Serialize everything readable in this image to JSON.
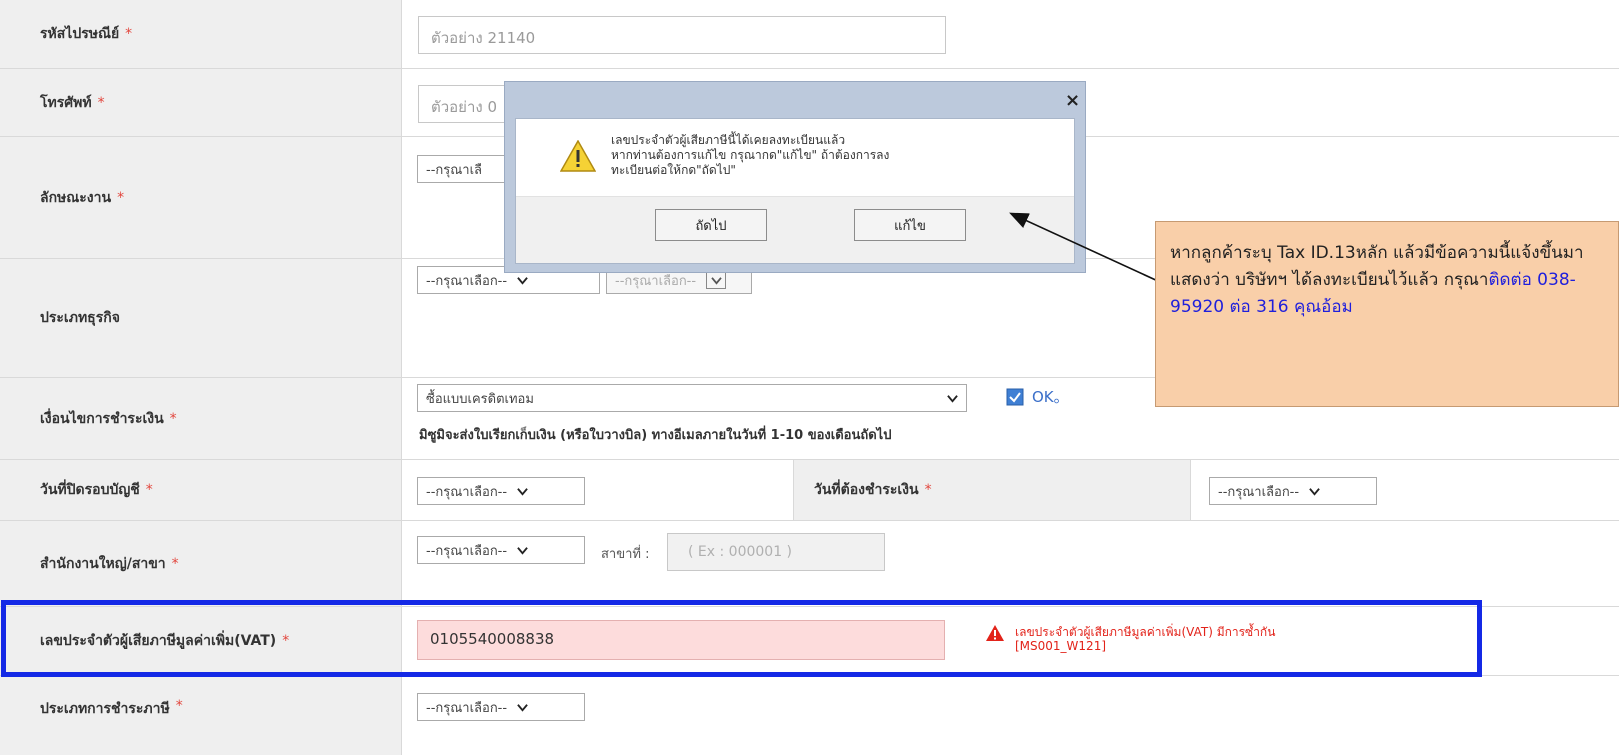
{
  "form": {
    "postal": {
      "label": "รหัสไปรษณีย์",
      "req": "*",
      "placeholder": "ตัวอย่าง 21140"
    },
    "phone": {
      "label": "โทรศัพท์",
      "req": "*",
      "placeholder": "ตัวอย่าง 0"
    },
    "job_type": {
      "label": "ลักษณะงาน",
      "req": "*",
      "select": "--กรุณาเลื"
    },
    "business_type": {
      "label": "ประเภทธุรกิจ",
      "select1": "--กรุณาเลือก--",
      "select2": "--กรุณาเลือก--"
    },
    "payment_terms": {
      "label": "เงื่อนไขการชำระเงิน",
      "req": "*",
      "select": "ซื้อแบบเครดิตเทอม",
      "ok_label": "OK。",
      "note": "มิซูมิจะส่งใบเรียกเก็บเงิน (หรือใบวางบิล) ทางอีเมลภายในวันที่ 1-10 ของเดือนถัดไป"
    },
    "closing_date": {
      "label": "วันที่ปิดรอบบัญชี",
      "req": "*",
      "select": "--กรุณาเลือก--"
    },
    "payment_date": {
      "label": "วันที่ต้องชำระเงิน",
      "req": "*",
      "select": "--กรุณาเลือก--"
    },
    "office": {
      "label": "สำนักงานใหญ่/สาขา",
      "req": "*",
      "select": "--กรุณาเลือก--",
      "branch_label": "สาขาที่ :",
      "branch_placeholder": "( Ex : 000001 )"
    },
    "vat": {
      "label": "เลขประจำตัวผู้เสียภาษีมูลค่าเพิ่ม(VAT)",
      "req": "*",
      "value": "0105540008838",
      "error_line1": "เลขประจำตัวผู้เสียภาษีมูลค่าเพิ่ม(VAT) มีการซ้ำกัน",
      "error_line2": "[MS001_W121]"
    },
    "tax_type": {
      "label": "ประเภทการชำระภาษี",
      "req": "*",
      "select": "--กรุณาเลือก--"
    }
  },
  "dialog": {
    "close": "×",
    "message_line1": "เลขประจำตัวผู้เสียภาษีนี้ได้เคยลงทะเบียนแล้ว",
    "message_line2": "หากท่านต้องการแก้ไข กรุณากด\"แก้ไข\" ถ้าต้องการลง",
    "message_line3": "ทะเบียนต่อให้กด\"ถัดไป\"",
    "next_button": "ถัดไป",
    "edit_button": "แก้ไข"
  },
  "callout": {
    "text1": "หากลูกค้าระบุ Tax ID.13หลัก แล้วมีข้อความนี้แจ้งขึ้นมาแสดงว่า บริษัทฯ ได้ลงทะเบียนไว้แล้ว กรุณา",
    "text2": "ติดต่อ 038-95920 ต่อ 316 คุณอ้อม"
  },
  "colors": {
    "highlight_border": "#1429e6",
    "callout_bg": "#f9cfa9",
    "error_red": "#e2231a",
    "vat_bg": "#fddcdc"
  }
}
